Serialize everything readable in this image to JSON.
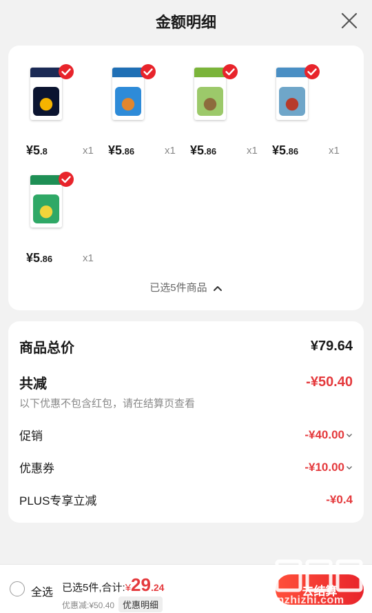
{
  "header": {
    "title": "金额明细"
  },
  "products": [
    {
      "price_main": "¥5",
      "price_dec": ".8",
      "qty": "x1",
      "cover": {
        "spine": "#1b2a55",
        "art": "#0b1430",
        "accent": "#f5b400"
      }
    },
    {
      "price_main": "¥5",
      "price_dec": ".86",
      "qty": "x1",
      "cover": {
        "spine": "#1f6fb5",
        "art": "#2e8bd8",
        "accent": "#e2862d"
      }
    },
    {
      "price_main": "¥5",
      "price_dec": ".86",
      "qty": "x1",
      "cover": {
        "spine": "#7bb43a",
        "art": "#9cc96a",
        "accent": "#8d6b3d"
      }
    },
    {
      "price_main": "¥5",
      "price_dec": ".86",
      "qty": "x1",
      "cover": {
        "spine": "#4a8fc4",
        "art": "#6fa6c9",
        "accent": "#b73b2a"
      }
    },
    {
      "price_main": "¥5",
      "price_dec": ".86",
      "qty": "x1",
      "cover": {
        "spine": "#1e8f55",
        "art": "#2fa866",
        "accent": "#f0d43a"
      }
    }
  ],
  "selection": {
    "summary": "已选5件商品"
  },
  "totals": {
    "goods_total_label": "商品总价",
    "goods_total_value": "¥79.64",
    "reduction_label": "共减",
    "reduction_value": "-¥50.40",
    "note": "以下优惠不包含红包，请在结算页查看",
    "promo_label": "促销",
    "promo_value": "-¥40.00",
    "coupon_label": "优惠券",
    "coupon_value": "-¥10.00",
    "plus_label": "PLUS专享立减",
    "plus_value": "-¥0.4"
  },
  "bottom": {
    "select_all": "全选",
    "summary_prefix": "已选5件,合计:",
    "total_symbol": "¥",
    "total_int": "29",
    "total_dec": ".24",
    "discount": "优惠减:¥50.40",
    "detail_button": "优惠明细",
    "checkout": "去结算"
  },
  "watermark": {
    "text": "znzhizhi.com"
  },
  "colors": {
    "accent": "#e4393c",
    "check": "#e8242b"
  }
}
